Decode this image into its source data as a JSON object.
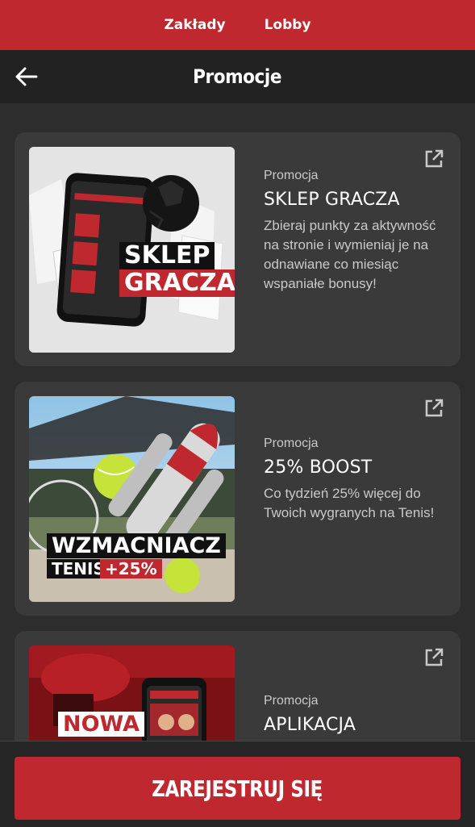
{
  "top_nav": {
    "items": [
      {
        "label": "Zakłady"
      },
      {
        "label": "Lobby"
      }
    ]
  },
  "header": {
    "title": "Promocje",
    "back_icon": "arrow-left-icon"
  },
  "promotions": [
    {
      "label": "Promocja",
      "title": "SKLEP GRACZA",
      "description": "Zbieraj punkty za aktywność na stronie i wymieniaj je na odnawiane co miesiąc wspaniałe bonusy!",
      "image_text": [
        "SKLEP",
        "GRACZA"
      ]
    },
    {
      "label": "Promocja",
      "title": "25% BOOST",
      "description": "Co tydzień 25% więcej do Twoich wygranych na Tenis!",
      "image_text": [
        "WZMACNIACZ",
        "TENIS",
        "+25%"
      ]
    },
    {
      "label": "Promocja",
      "title": "APLIKACJA",
      "description": "",
      "image_text": [
        "NOWA"
      ]
    }
  ],
  "register_button": {
    "label": "ZAREJESTRUJ SIĘ"
  },
  "colors": {
    "brand_red": "#c0282f",
    "background": "#2d2d2d",
    "card": "#3a3a3a",
    "header": "#222222"
  }
}
